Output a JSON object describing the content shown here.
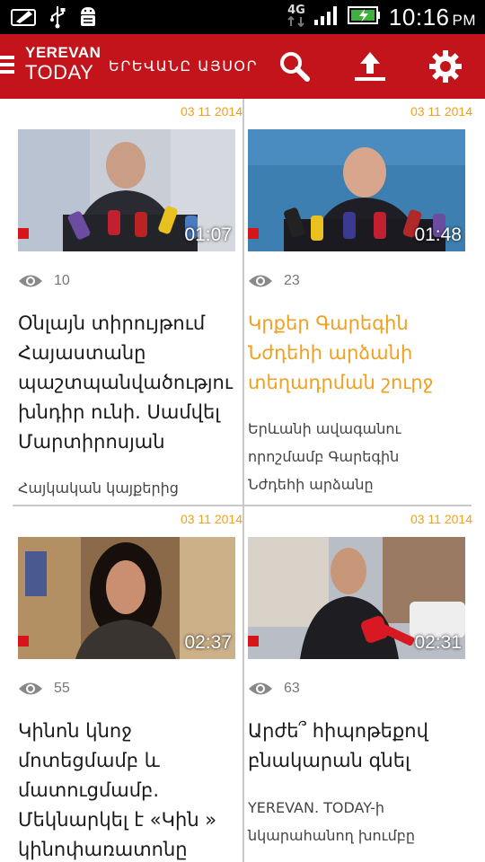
{
  "status_bar": {
    "network": "4G",
    "time": "10:16",
    "ampm": "PM",
    "icons": [
      "notification-icon",
      "usb-icon",
      "android-debug-icon",
      "signal-icon",
      "battery-charging-icon"
    ]
  },
  "app_bar": {
    "logo_top": "YEREVAN",
    "logo_bottom": "TODAY",
    "subtitle": "ԵՐԵՎԱՆԸ ԱՅՍՕՐ",
    "actions": [
      "search-icon",
      "upload-icon",
      "settings-icon"
    ],
    "color": "#c3141b"
  },
  "cards": [
    {
      "date": "03 11 2014",
      "duration": "01:07",
      "views": "10",
      "title": "Օնլայն տիրույթում\nՀայաստանը\nպաշտպանվածությու\nխնդիր ունի. Սամվել\nՄարտիրոսյան",
      "summary": "Հայկական կայքերից"
    },
    {
      "date": "03 11 2014",
      "duration": "01:48",
      "views": "23",
      "title": "Կրքեր Գարեգին\nՆժդեհի արձանի\nտեղադրման շուրջ",
      "summary": "Երևանի ավագանու\nորոշմամբ Գարեգին\nՆժդեհի արձանը"
    },
    {
      "date": "03 11 2014",
      "duration": "02:37",
      "views": "55",
      "title": "Կինոն կնոջ\nմոտեցմամբ և\nմատուցմամբ.\nՄեկնարկել է «Կին »\nկինոփառատոնը",
      "summary": ""
    },
    {
      "date": "03 11 2014",
      "duration": "02:31",
      "views": "63",
      "title": "Արժե՞ հիպոթեքով\nբնակարան գնել",
      "summary": "YEREVAN. TODAY-ի\nնկարահանող խումբը"
    }
  ],
  "colors": {
    "accent": "#c3141b",
    "date": "#f0a020",
    "highlight_title": "#f0a020"
  }
}
